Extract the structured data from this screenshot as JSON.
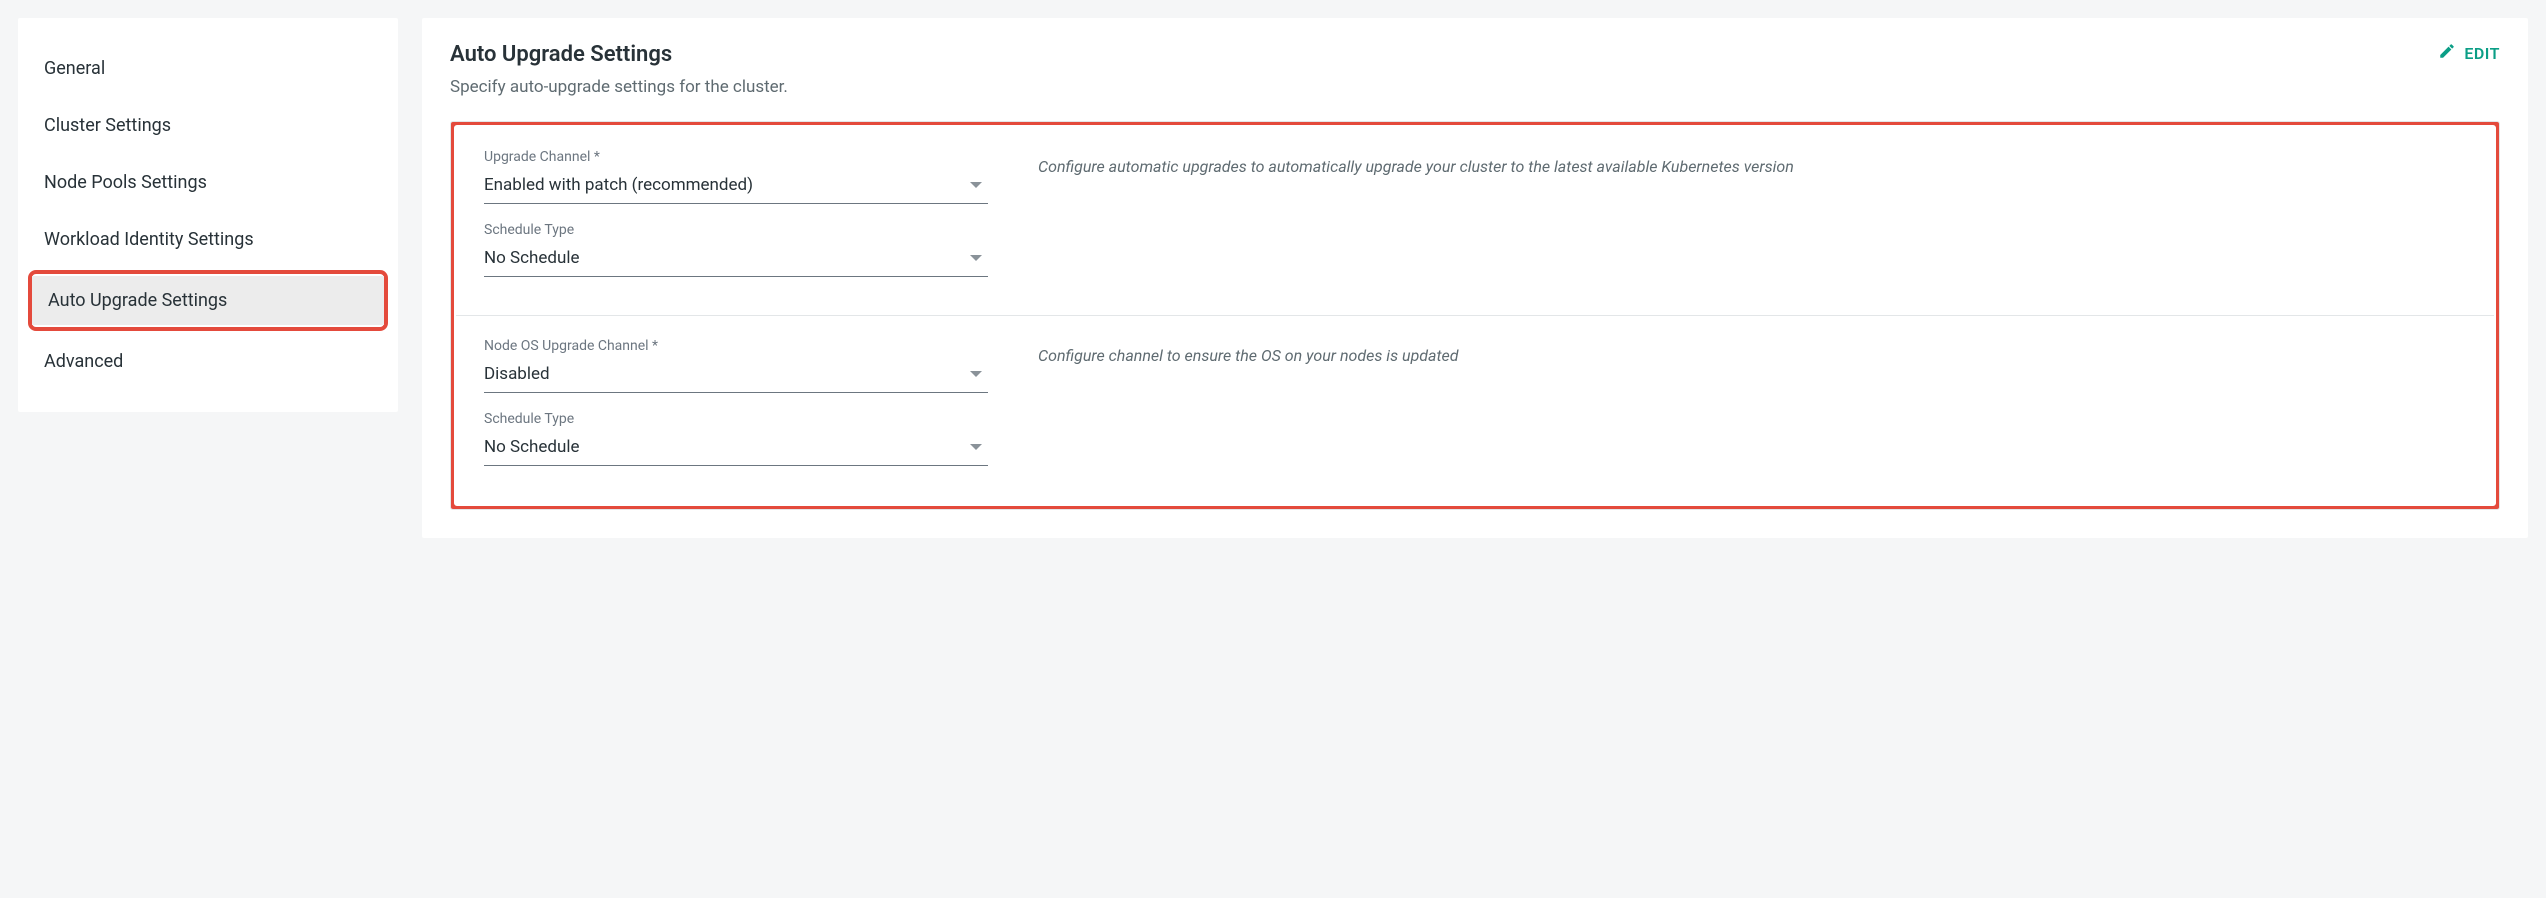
{
  "sidebar": {
    "items": [
      {
        "label": "General"
      },
      {
        "label": "Cluster Settings"
      },
      {
        "label": "Node Pools Settings"
      },
      {
        "label": "Workload Identity Settings"
      },
      {
        "label": "Auto Upgrade Settings"
      },
      {
        "label": "Advanced"
      }
    ]
  },
  "header": {
    "title": "Auto Upgrade Settings",
    "subtitle": "Specify auto-upgrade settings for the cluster.",
    "edit_label": "EDIT"
  },
  "sections": [
    {
      "description": "Configure automatic upgrades to automatically upgrade your cluster to the latest available Kubernetes version",
      "fields": [
        {
          "label": "Upgrade Channel *",
          "value": "Enabled with patch (recommended)"
        },
        {
          "label": "Schedule Type",
          "value": "No Schedule"
        }
      ]
    },
    {
      "description": "Configure channel to ensure the OS on your nodes is updated",
      "fields": [
        {
          "label": "Node OS Upgrade Channel *",
          "value": "Disabled"
        },
        {
          "label": "Schedule Type",
          "value": "No Schedule"
        }
      ]
    }
  ]
}
